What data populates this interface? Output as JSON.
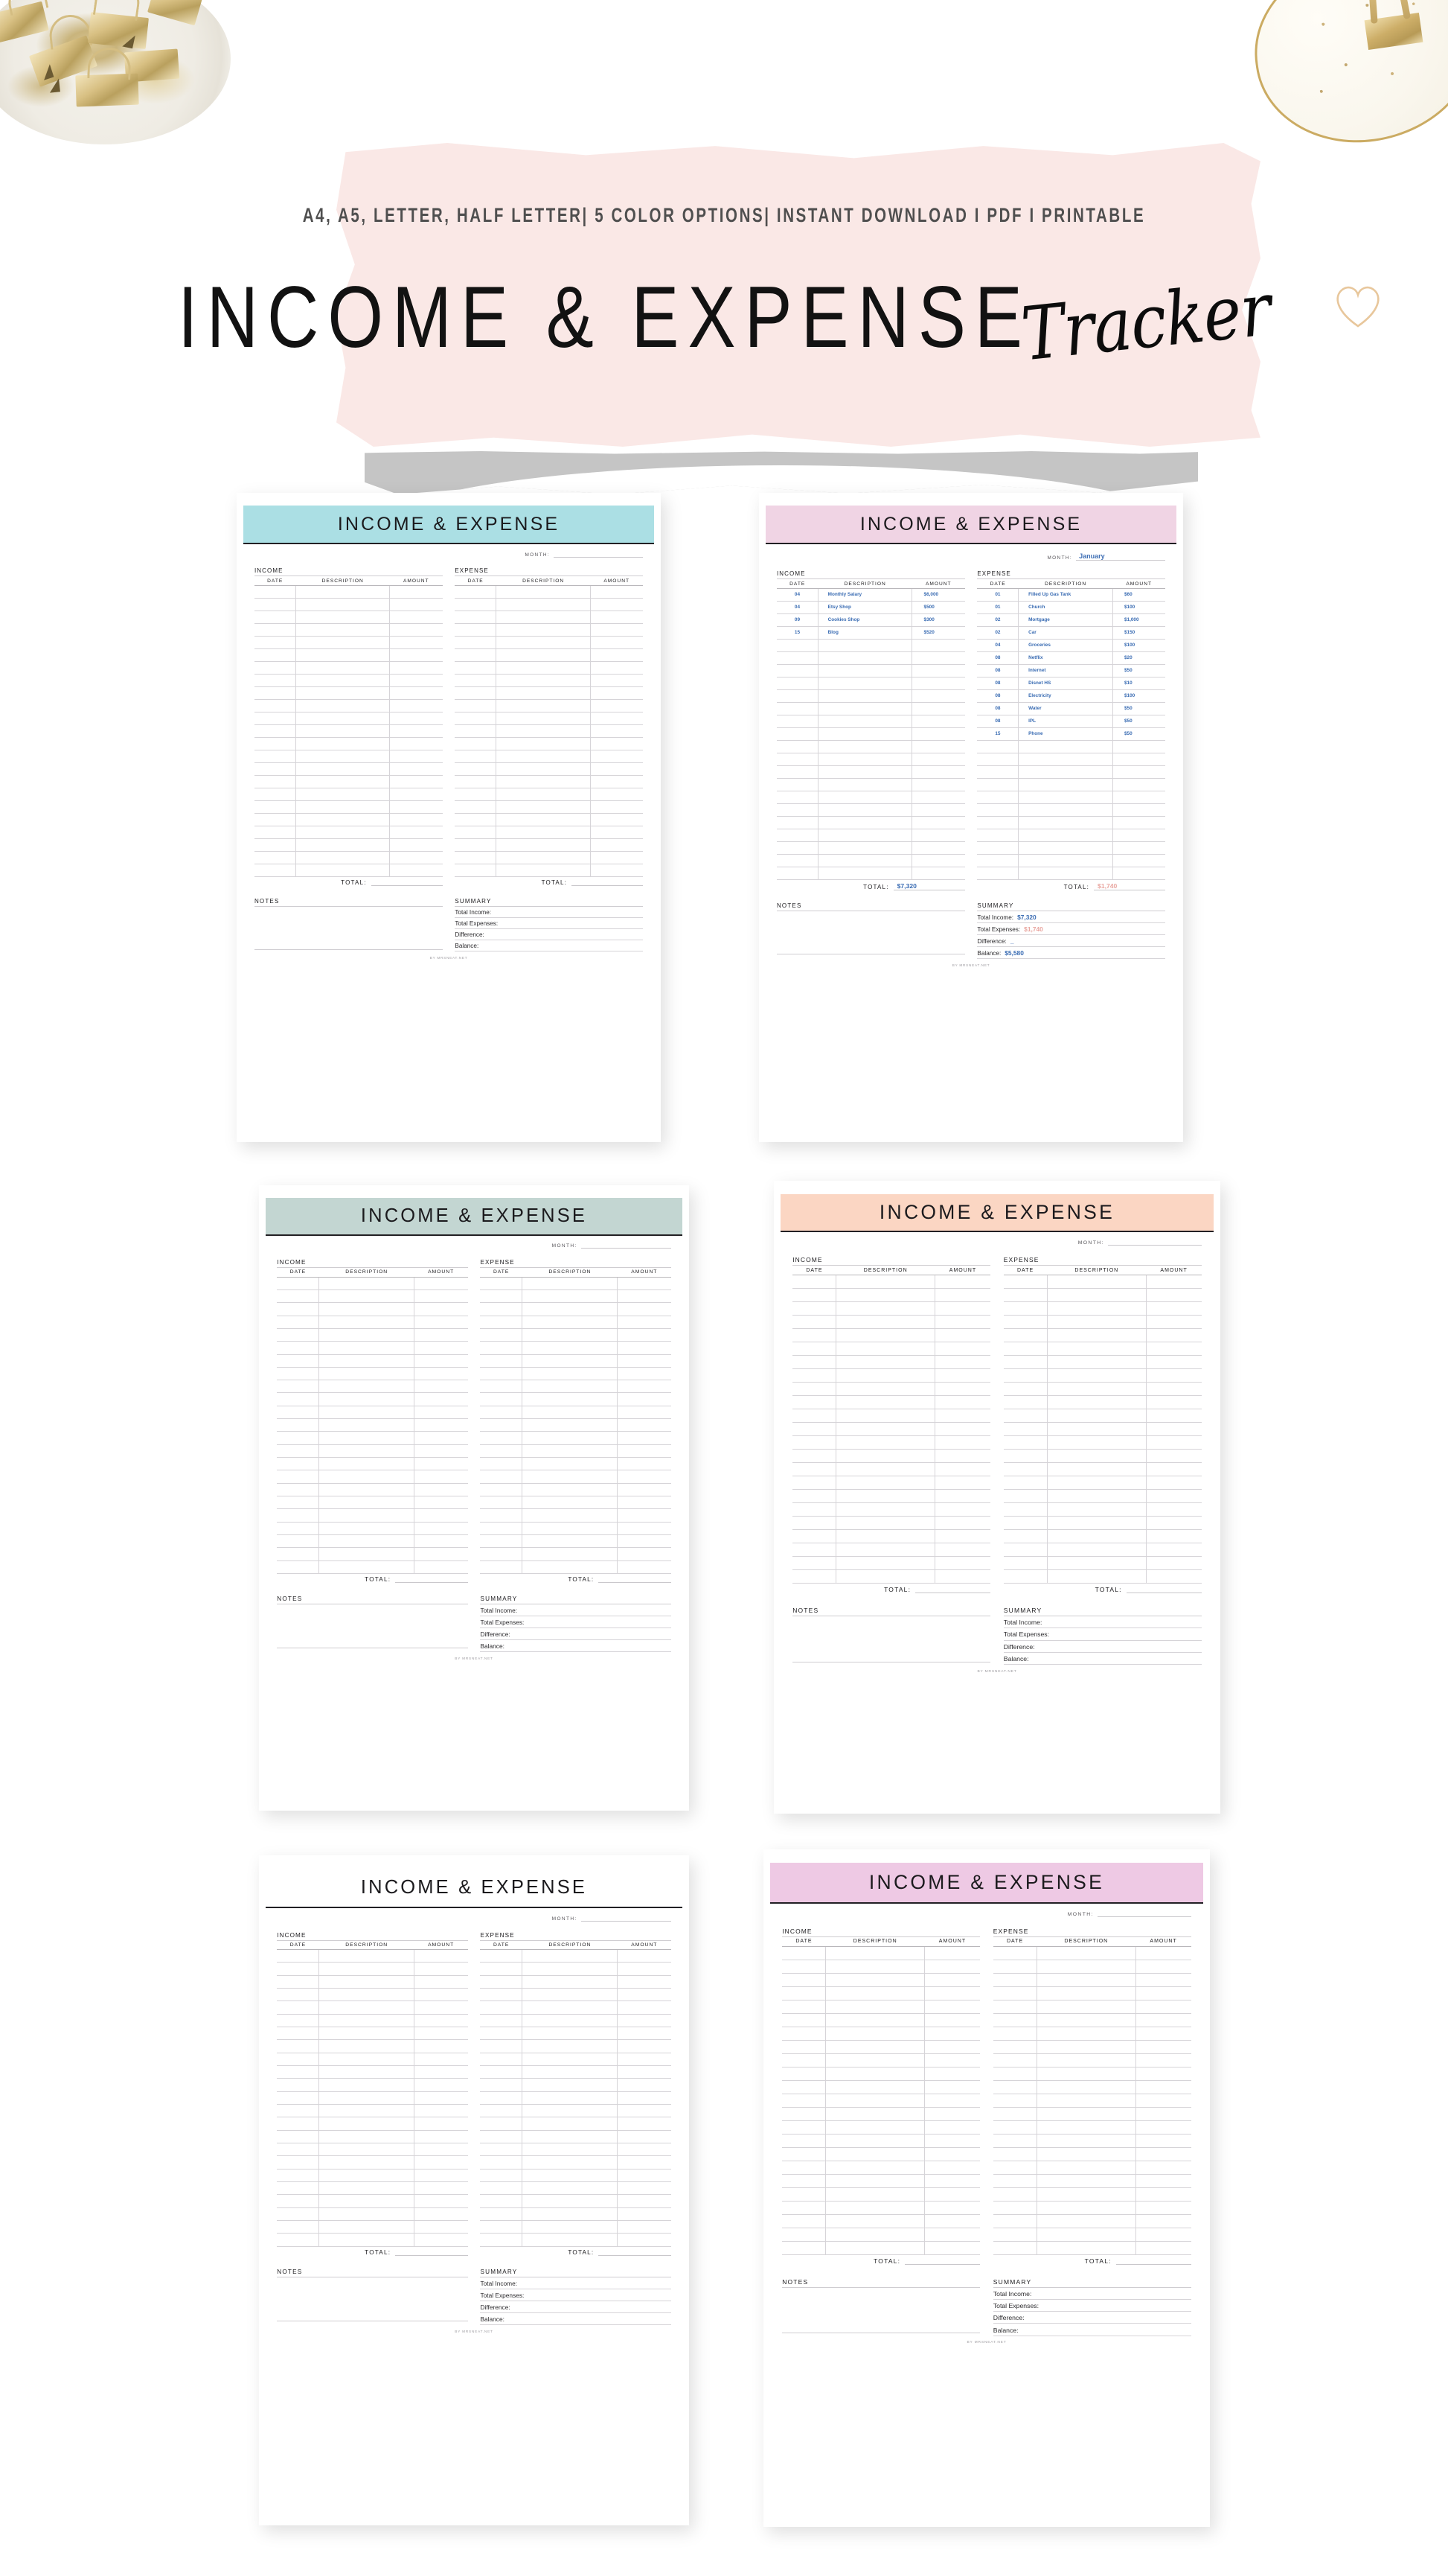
{
  "hero": {
    "subtitle": "A4, A5, LETTER, HALF LETTER| 5 COLOR OPTIONS| INSTANT DOWNLOAD I PDF I PRINTABLE",
    "title_main": "INCOME  &  EXPENSE",
    "title_script": "Tracker"
  },
  "sheet": {
    "band_title": "INCOME & EXPENSE",
    "month_label": "MONTH:",
    "income_caption": "INCOME",
    "expense_caption": "EXPENSE",
    "columns": [
      "DATE",
      "DESCRIPTION",
      "AMOUNT"
    ],
    "total_label": "TOTAL:",
    "notes_label": "NOTES",
    "summary_label": "SUMMARY",
    "summary_rows": [
      "Total Income:",
      "Total Expenses:",
      "Difference:",
      "Balance:"
    ],
    "credit": "BY MRSNEAT.NET",
    "blank_rows": 23
  },
  "colors": {
    "mint": "#abdfe4",
    "pink_lilac": "#f0d4e4",
    "sage": "#c3d6d2",
    "peach": "#fbd6c3",
    "white": "#ffffff",
    "lilac": "#eec9e4",
    "wash": "#fae8e6",
    "tape_gray": "#c5c5c5",
    "ink": "#1b1a1d",
    "value_blue": "#3a6cb3",
    "value_pink": "#e9a6a0"
  },
  "variants": [
    {
      "id": "mint",
      "band_color": "#abdfe4",
      "filled": false
    },
    {
      "id": "pink-lilac",
      "band_color": "#f0d4e4",
      "filled": true
    },
    {
      "id": "sage",
      "band_color": "#c3d6d2",
      "filled": false
    },
    {
      "id": "peach",
      "band_color": "#fbd6c3",
      "filled": false
    },
    {
      "id": "white",
      "band_color": "transparent",
      "filled": false
    },
    {
      "id": "lilac",
      "band_color": "#eec9e4",
      "filled": false
    }
  ],
  "filled_example": {
    "month_value": "January",
    "income_rows": [
      {
        "date": "04",
        "description": "Monthly Salary",
        "amount": "$6,000"
      },
      {
        "date": "04",
        "description": "Etsy Shop",
        "amount": "$500"
      },
      {
        "date": "09",
        "description": "Cookies Shop",
        "amount": "$300"
      },
      {
        "date": "15",
        "description": "Blog",
        "amount": "$520"
      }
    ],
    "expense_rows": [
      {
        "date": "01",
        "description": "Filled Up Gas Tank",
        "amount": "$60"
      },
      {
        "date": "01",
        "description": "Church",
        "amount": "$100"
      },
      {
        "date": "02",
        "description": "Mortgage",
        "amount": "$1,000"
      },
      {
        "date": "02",
        "description": "Car",
        "amount": "$150"
      },
      {
        "date": "04",
        "description": "Groceries",
        "amount": "$100"
      },
      {
        "date": "08",
        "description": "Netflix",
        "amount": "$20"
      },
      {
        "date": "08",
        "description": "Internet",
        "amount": "$50"
      },
      {
        "date": "08",
        "description": "Disnet HS",
        "amount": "$10"
      },
      {
        "date": "08",
        "description": "Electricity",
        "amount": "$100"
      },
      {
        "date": "08",
        "description": "Water",
        "amount": "$50"
      },
      {
        "date": "08",
        "description": "IPL",
        "amount": "$50"
      },
      {
        "date": "15",
        "description": "Phone",
        "amount": "$50"
      }
    ],
    "income_total": "$7,320",
    "expense_total": "$1,740",
    "summary_values": [
      "$7,320",
      "$1,740",
      "_",
      "$5,580"
    ]
  }
}
